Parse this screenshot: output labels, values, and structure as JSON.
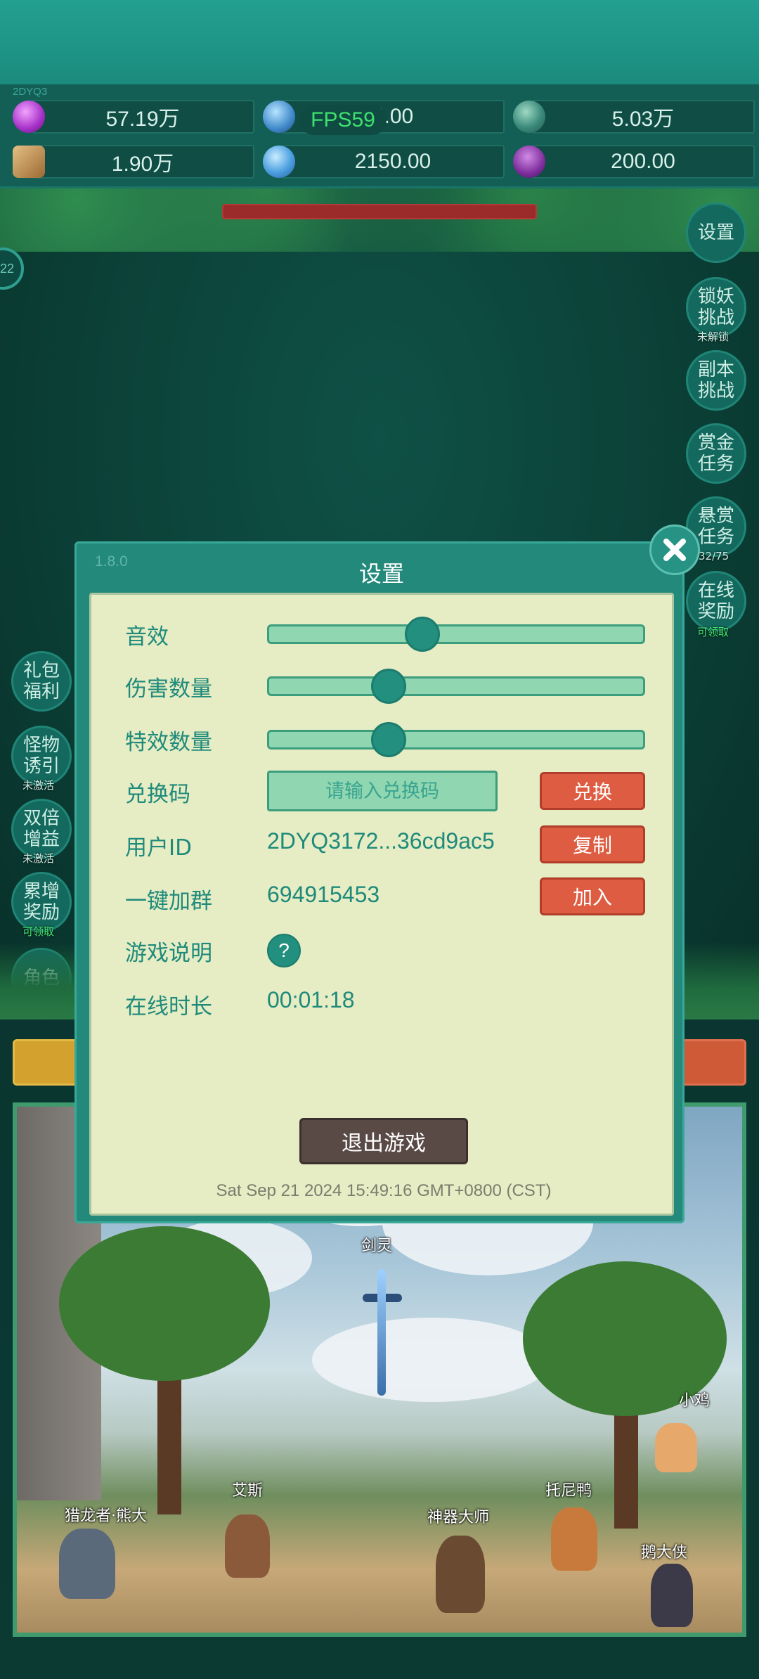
{
  "debug": {
    "id_tag": "2DYQ3",
    "fps": "FPS59",
    "badge": "22"
  },
  "resources": [
    {
      "icon": "purple-gem-icon",
      "value": "57.19万"
    },
    {
      "icon": "blue-orb-icon",
      "value": "4.00"
    },
    {
      "icon": "earth-orb-icon",
      "value": "5.03万"
    },
    {
      "icon": "scroll-icon",
      "value": "1.90万"
    },
    {
      "icon": "blue-crystal-icon",
      "value": "2150.00"
    },
    {
      "icon": "purple-pouch-icon",
      "value": "200.00"
    }
  ],
  "right_menu": [
    {
      "label": "设置",
      "sub": ""
    },
    {
      "label": "锁妖挑战",
      "sub": "未解锁"
    },
    {
      "label": "副本挑战",
      "sub": ""
    },
    {
      "label": "赏金任务",
      "sub": ""
    },
    {
      "label": "悬赏任务",
      "sub": "32/75"
    },
    {
      "label": "在线奖励",
      "sub": "可领取"
    }
  ],
  "left_menu": [
    {
      "label": "礼包福利",
      "sub": ""
    },
    {
      "label": "怪物诱引",
      "sub": "未激活"
    },
    {
      "label": "双倍增益",
      "sub": "未激活"
    },
    {
      "label": "累增奖励",
      "sub": "可领取"
    },
    {
      "label": "角色",
      "sub": ""
    }
  ],
  "scene": {
    "characters": [
      "剑灵",
      "小鸡",
      "艾斯",
      "托尼鸭",
      "猎龙者·熊大",
      "神器大师",
      "鹅大侠"
    ]
  },
  "settings": {
    "version": "1.8.0",
    "title": "设置",
    "sound_label": "音效",
    "sound_level": 0.4,
    "damage_label": "伤害数量",
    "damage_level": 0.3,
    "effects_label": "特效数量",
    "effects_level": 0.3,
    "redeem_label": "兑换码",
    "redeem_placeholder": "请输入兑换码",
    "redeem_button": "兑换",
    "user_id_label": "用户ID",
    "user_id_value": "2DYQ3172...36cd9ac5",
    "copy_button": "复制",
    "group_label": "一键加群",
    "group_value": "694915453",
    "join_button": "加入",
    "help_label": "游戏说明",
    "help_icon_text": "?",
    "online_label": "在线时长",
    "online_value": "00:01:18",
    "quit_button": "退出游戏",
    "datetime": "Sat Sep 21 2024 15:49:16 GMT+0800 (CST)"
  },
  "colors": {
    "accent": "#23897b",
    "panel": "#e6ecc3",
    "danger": "#dd5c42"
  }
}
